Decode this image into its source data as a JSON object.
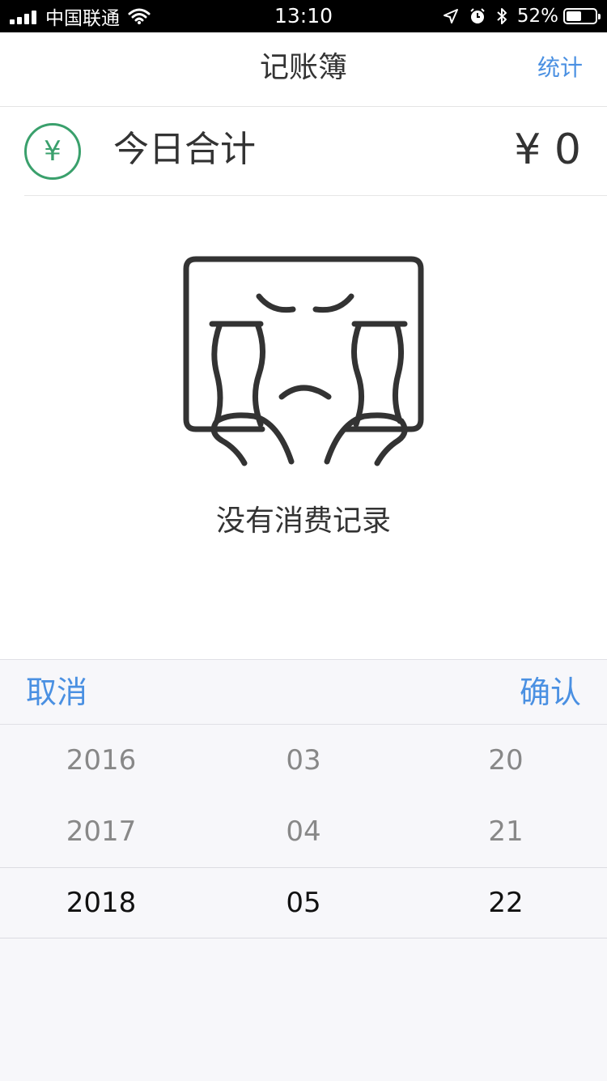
{
  "status_bar": {
    "carrier": "中国联通",
    "time": "13:10",
    "battery_percent": "52%",
    "battery_level": 0.52,
    "icons": [
      "signal-icon",
      "wifi-icon",
      "location-icon",
      "alarm-icon",
      "bluetooth-icon",
      "battery-icon"
    ]
  },
  "nav": {
    "title": "记账簿",
    "action_label": "统计"
  },
  "summary": {
    "icon": "yen-icon",
    "icon_glyph": "¥",
    "label": "今日合计",
    "amount": "¥ 0"
  },
  "empty_state": {
    "illustration": "crying-face-icon",
    "message": "没有消费记录"
  },
  "picker": {
    "cancel_label": "取消",
    "confirm_label": "确认",
    "rows": [
      {
        "year": "2016",
        "month": "03",
        "day": "20"
      },
      {
        "year": "2017",
        "month": "04",
        "day": "21"
      },
      {
        "year": "2018",
        "month": "05",
        "day": "22"
      }
    ],
    "selected": {
      "year": "2018",
      "month": "05",
      "day": "22"
    }
  },
  "colors": {
    "accent": "#4a90e2",
    "yen_green": "#3aa06c",
    "text": "#333333",
    "picker_bg": "#f7f7fa"
  }
}
